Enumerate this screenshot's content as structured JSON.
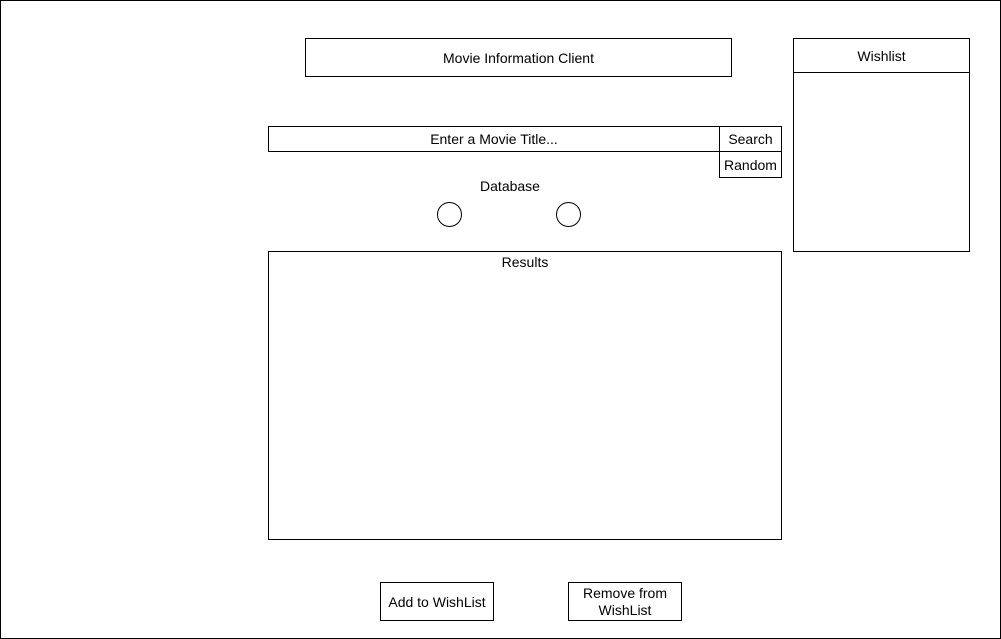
{
  "header": {
    "title": "Movie Information Client"
  },
  "wishlist": {
    "title": "Wishlist",
    "items": []
  },
  "search": {
    "placeholder": "Enter a Movie Title...",
    "search_label": "Search",
    "random_label": "Random"
  },
  "database": {
    "label": "Database",
    "options": [
      "",
      ""
    ]
  },
  "results": {
    "label": "Results"
  },
  "actions": {
    "add_label": "Add to WishList",
    "remove_label": "Remove from WishList"
  }
}
